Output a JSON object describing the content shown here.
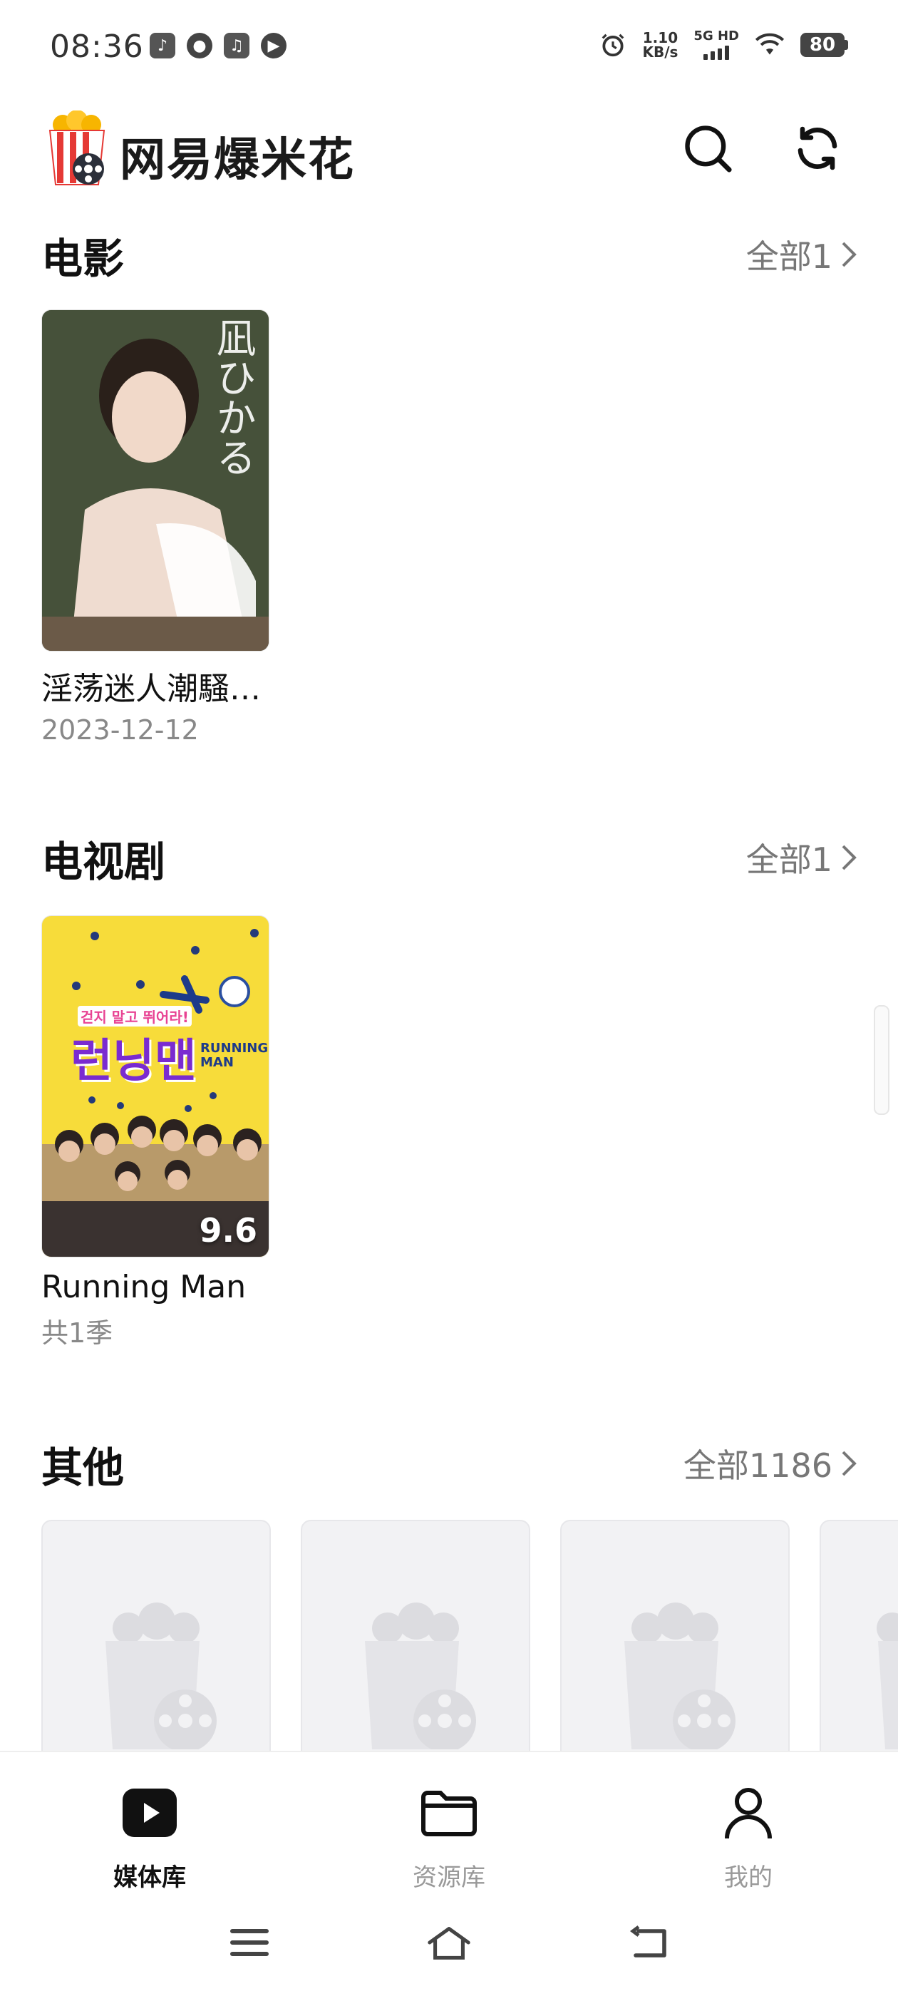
{
  "status_bar": {
    "time": "08:36",
    "speed_value": "1.10",
    "speed_unit": "KB/s",
    "network": "5G HD",
    "battery": "80"
  },
  "header": {
    "title": "网易爆米花"
  },
  "sections": {
    "movies": {
      "title": "电影",
      "all_label": "全部1",
      "items": [
        {
          "title": "淫荡迷人潮騷…",
          "subtitle": "2023-12-12",
          "poster_text": "凪ひかる"
        }
      ]
    },
    "tv": {
      "title": "电视剧",
      "all_label": "全部1",
      "items": [
        {
          "title": "Running Man",
          "subtitle": "共1季",
          "rating": "9.6",
          "poster_text": "런닝맨",
          "poster_tagline": "걷지 말고 뛰어라!",
          "poster_badge": "RUNNING MAN"
        }
      ]
    },
    "other": {
      "title": "其他",
      "all_label": "全部1186"
    }
  },
  "bottom_nav": {
    "items": [
      {
        "label": "媒体库",
        "icon": "play-icon",
        "active": true
      },
      {
        "label": "资源库",
        "icon": "folder-icon",
        "active": false
      },
      {
        "label": "我的",
        "icon": "person-icon",
        "active": false
      }
    ]
  },
  "colors": {
    "tv_poster_bg": "#f7dc3a",
    "placeholder_bg": "#f2f2f4",
    "accent": "#111111",
    "muted": "#777777"
  }
}
